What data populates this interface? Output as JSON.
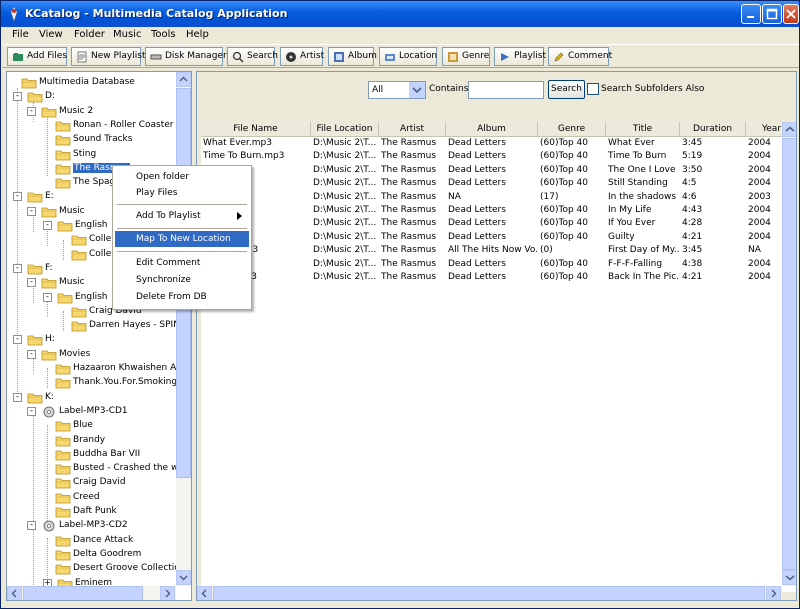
{
  "window": {
    "title": "KCatalog - Multimedia Catalog Application"
  },
  "menu": [
    "File",
    "View",
    "Folder",
    "Music",
    "Tools",
    "Help"
  ],
  "toolbar": {
    "add_files": "Add Files",
    "new_playlist": "New Playlist",
    "disk_manager": "Disk Manager",
    "search": "Search",
    "artist": "Artist",
    "album": "Album",
    "location": "Location",
    "genre": "Genre",
    "playlist": "Playlist",
    "comment": "Comment"
  },
  "tree": {
    "root": "Multimedia Database",
    "d_drive": "D:",
    "music2": "Music 2",
    "ronan": "Ronan - Roller Coaster",
    "soundtracks": "Sound Tracks",
    "sting": "Sting",
    "rasmus": "The Rasmus",
    "spag": "The Spag",
    "e_drive": "E:",
    "e_music": "Music",
    "e_english": "English",
    "e_colle1": "Colle",
    "e_colle2": "Colle",
    "f_drive": "F:",
    "f_music": "Music",
    "f_english": "English",
    "craig": "Craig David",
    "darren": "Darren Hayes - SPIN",
    "h_drive": "H:",
    "movies": "Movies",
    "hazaaron": "Hazaaron Khwaishen Ais",
    "thankyou": "Thank.You.For.Smoking[",
    "k_drive": "K:",
    "cd1": "Label-MP3-CD1",
    "blue": "Blue",
    "brandy": "Brandy",
    "buddha": "Buddha Bar VII",
    "busted": "Busted - Crashed the we",
    "craig2": "Craig David",
    "creed": "Creed",
    "daft": "Daft Punk",
    "cd2": "Label-MP3-CD2",
    "dance": "Dance Attack",
    "delta": "Delta Goodrem",
    "desert": "Desert Groove  Collection",
    "eminem": "Eminem"
  },
  "search": {
    "scope": "All",
    "contains_label": "Contains",
    "query": "",
    "button": "Search",
    "subfolders_label": "Search Subfolders Also",
    "subfolders_checked": false
  },
  "columns": [
    "File Name",
    "File Location",
    "Artist",
    "Album",
    "Genre",
    "Title",
    "Duration",
    "Year"
  ],
  "rows": [
    [
      "What Ever.mp3",
      "D:\\Music 2\\T...",
      "The Rasmus",
      "Dead Letters",
      "(60)Top 40",
      "What Ever",
      "3:45",
      "2004"
    ],
    [
      "Time To Burn.mp3",
      "D:\\Music 2\\T...",
      "The Rasmus",
      "Dead Letters",
      "(60)Top 40",
      "Time To Burn",
      "5:19",
      "2004"
    ],
    [
      "ve.mp3",
      "D:\\Music 2\\T...",
      "The Rasmus",
      "Dead Letters",
      "(60)Top 40",
      "The One I Love",
      "3:50",
      "2004"
    ],
    [
      "g.mp3",
      "D:\\Music 2\\T...",
      "The Rasmus",
      "Dead Letters",
      "(60)Top 40",
      "Still Standing",
      "4:5",
      "2004"
    ],
    [
      "ows.mp3",
      "D:\\Music 2\\T...",
      "The Rasmus",
      "NA",
      "(17)",
      "In the shadows",
      "4:6",
      "2003"
    ],
    [
      "p3",
      "D:\\Music 2\\T...",
      "The Rasmus",
      "Dead Letters",
      "(60)Top 40",
      "In My Life",
      "4:43",
      "2004"
    ],
    [
      "",
      "D:\\Music 2\\T...",
      "The Rasmus",
      "Dead Letters",
      "(60)Top 40",
      "If You Ever",
      "4:28",
      "2004"
    ],
    [
      "",
      "D:\\Music 2\\T...",
      "The Rasmus",
      "Dead Letters",
      "(60)Top 40",
      "Guilty",
      "4:21",
      "2004"
    ],
    [
      "My Life.mp3",
      "D:\\Music 2\\T...",
      "The Rasmus",
      "All The Hits Now Vo...",
      "(0)",
      "First Day of My...",
      "3:45",
      "NA"
    ],
    [
      ".mp3",
      "D:\\Music 2\\T...",
      "The Rasmus",
      "Dead Letters",
      "(60)Top 40",
      "F-F-F-Falling",
      "4:38",
      "2004"
    ],
    [
      "Picture.mp3",
      "D:\\Music 2\\T...",
      "The Rasmus",
      "Dead Letters",
      "(60)Top 40",
      "Back In The Pic...",
      "4:21",
      "2004"
    ]
  ],
  "context_menu": {
    "open_folder": "Open folder",
    "play_files": "Play Files",
    "add_to_playlist": "Add To Playlist",
    "map_location": "Map To New Location",
    "edit_comment": "Edit Comment",
    "synchronize": "Synchronize",
    "delete": "Delete From DB"
  }
}
